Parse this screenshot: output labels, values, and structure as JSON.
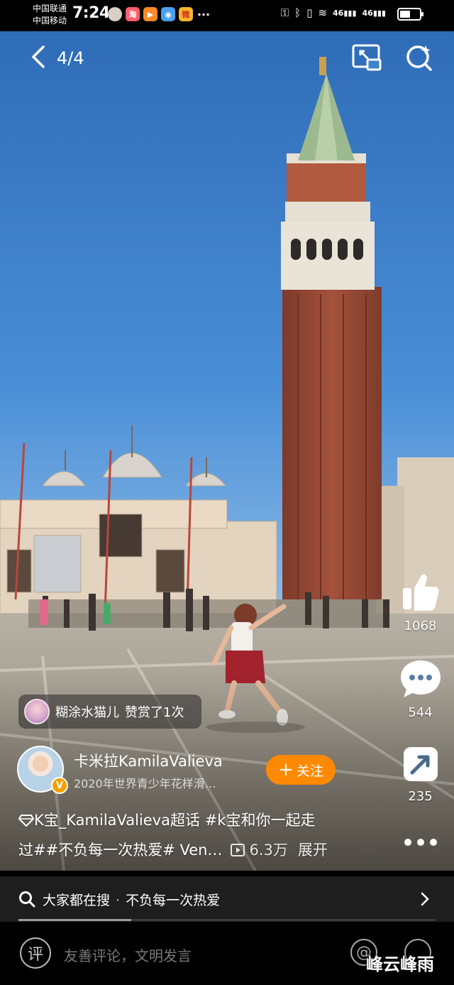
{
  "status_bar": {
    "carrier_1": "中国联通",
    "carrier_2": "中国移动",
    "time": "7:24",
    "notif_labels": {
      "shop": "淘",
      "weibo": "微"
    },
    "more": "···",
    "signal_1": "46",
    "signal_2": "46"
  },
  "header": {
    "page_indicator": "4/4"
  },
  "actions": {
    "like_count": "1068",
    "comment_count": "544",
    "share_count": "235"
  },
  "reward": {
    "user": "糊涂水猫儿",
    "text": "赞赏了1次"
  },
  "author": {
    "name": "卡米拉KamilaValieva",
    "subtitle": "2020年世界青少年花样滑…",
    "verified_mark": "V",
    "follow_label": "关注"
  },
  "caption": {
    "line1": "K宝_KamilaValieva超话 #k宝和你一起走",
    "line2": "过##不负每一次热爱# Ven…",
    "views": "6.3万",
    "expand": "展开"
  },
  "search": {
    "label": "大家都在搜",
    "separator": "·",
    "query": "不负每一次热爱"
  },
  "progress": {
    "fraction": 0.27
  },
  "comment_bar": {
    "icon_label": "评",
    "placeholder": "友善评论，文明发言",
    "at_label": "@"
  },
  "watermark": "峰云峰雨",
  "colors": {
    "follow": "#ff8a00",
    "verified": "#f5a000",
    "sky": "#3f83cc",
    "brick": "#9a4a35"
  }
}
